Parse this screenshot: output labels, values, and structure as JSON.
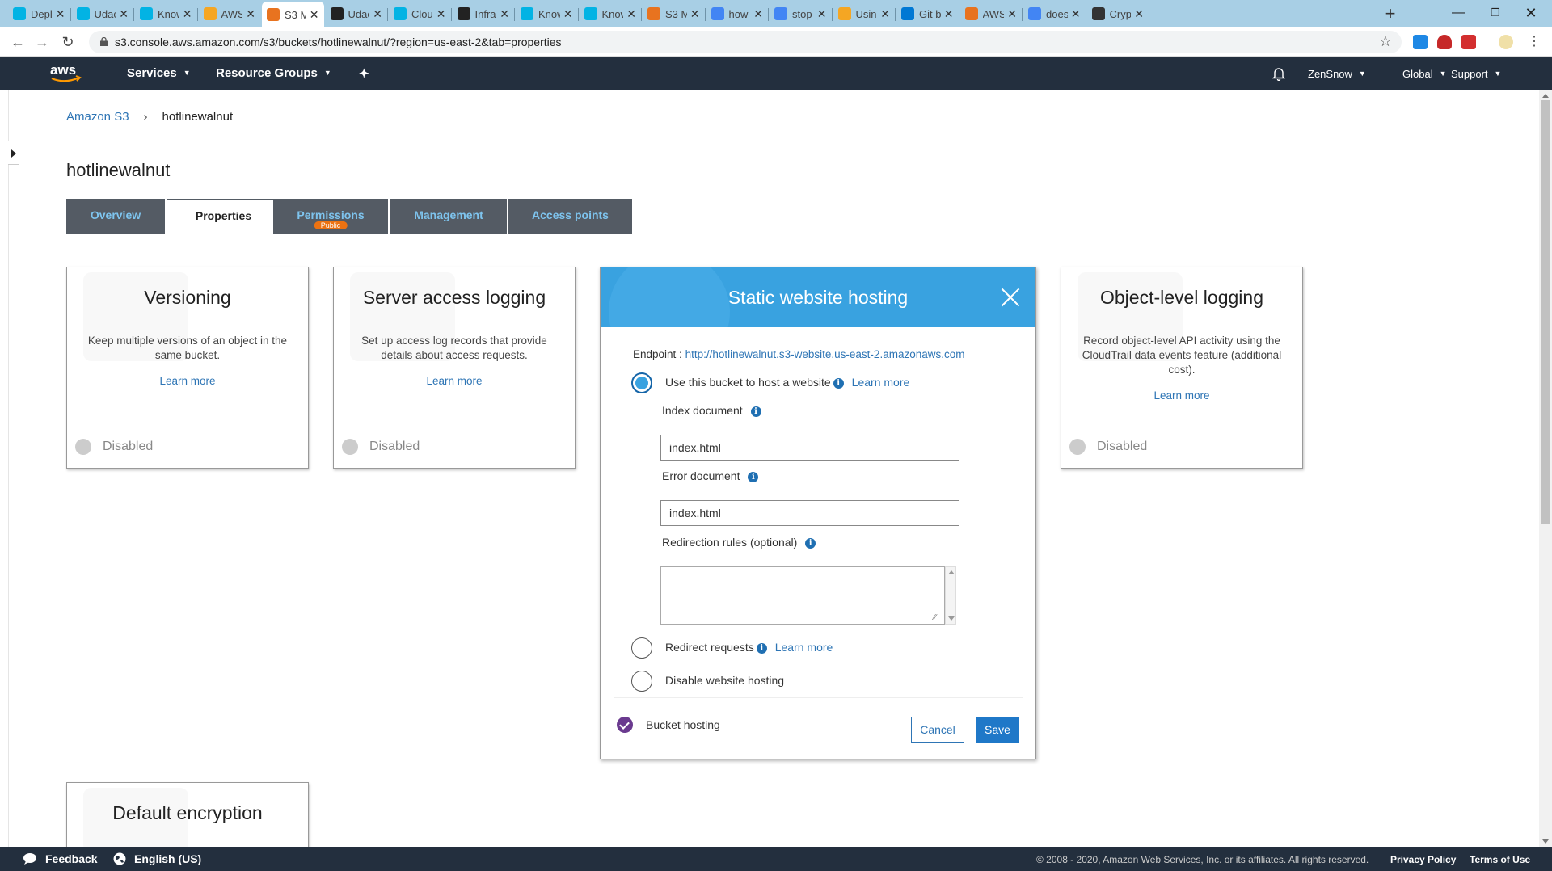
{
  "browser": {
    "tabs": [
      {
        "title": "Deplo",
        "icon": "udacity-icon",
        "color": "#02b3e4"
      },
      {
        "title": "Udaci",
        "icon": "udacity-icon",
        "color": "#02b3e4"
      },
      {
        "title": "Know",
        "icon": "udacity-icon",
        "color": "#02b3e4"
      },
      {
        "title": "AWS",
        "icon": "aws-box-icon",
        "color": "#f5a623"
      },
      {
        "title": "S3 M",
        "icon": "aws-s3-icon",
        "color": "#e8731f"
      },
      {
        "title": "Udaci",
        "icon": "github-icon",
        "color": "#222222"
      },
      {
        "title": "Clouc",
        "icon": "udacity-icon",
        "color": "#02b3e4"
      },
      {
        "title": "Infras",
        "icon": "wikipedia-icon",
        "color": "#222222"
      },
      {
        "title": "Know",
        "icon": "udacity-icon",
        "color": "#02b3e4"
      },
      {
        "title": "Know",
        "icon": "udacity-icon",
        "color": "#02b3e4"
      },
      {
        "title": "S3 M",
        "icon": "aws-s3-icon",
        "color": "#e8731f"
      },
      {
        "title": "how t",
        "icon": "google-icon",
        "color": "#4285f4"
      },
      {
        "title": "stop",
        "icon": "google-icon",
        "color": "#4285f4"
      },
      {
        "title": "Using",
        "icon": "aws-box-icon",
        "color": "#f5a623"
      },
      {
        "title": "Git b",
        "icon": "azure-icon",
        "color": "#0078d4"
      },
      {
        "title": "AWS",
        "icon": "aws-s3-icon",
        "color": "#e8731f"
      },
      {
        "title": "does",
        "icon": "google-icon",
        "color": "#4285f4"
      },
      {
        "title": "Crypt",
        "icon": "crypto-icon",
        "color": "#333333"
      }
    ],
    "active_tab_index": 4,
    "url": "s3.console.aws.amazon.com/s3/buckets/hotlinewalnut/?region=us-east-2&tab=properties"
  },
  "awsnav": {
    "services": "Services",
    "resource_groups": "Resource Groups",
    "user": "ZenSnow",
    "region": "Global",
    "support": "Support"
  },
  "breadcrumb": {
    "root": "Amazon S3",
    "current": "hotlinewalnut"
  },
  "bucket": {
    "name": "hotlinewalnut"
  },
  "tabs": {
    "overview": "Overview",
    "properties": "Properties",
    "permissions": "Permissions",
    "permissions_badge": "Public",
    "management": "Management",
    "access_points": "Access points"
  },
  "cards": {
    "versioning": {
      "title": "Versioning",
      "description": "Keep multiple versions of an object in the same bucket.",
      "link": "Learn more",
      "status": "Disabled"
    },
    "server_logging": {
      "title": "Server access logging",
      "description": "Set up access log records that provide details about access requests.",
      "link": "Learn more",
      "status": "Disabled"
    },
    "object_logging": {
      "title": "Object-level logging",
      "description": "Record object-level API activity using the CloudTrail data events feature (additional cost).",
      "link": "Learn more",
      "status": "Disabled"
    },
    "default_encryption": {
      "title": "Default encryption"
    }
  },
  "static_hosting": {
    "title": "Static website hosting",
    "endpoint_label": "Endpoint :",
    "endpoint_url": "http://hotlinewalnut.s3-website.us-east-2.amazonaws.com",
    "option_host": "Use this bucket to host a website",
    "learn_more": "Learn more",
    "index_label": "Index document",
    "index_value": "index.html",
    "error_label": "Error document",
    "error_value": "index.html",
    "rules_label": "Redirection rules (optional)",
    "option_redirect": "Redirect requests",
    "option_disable": "Disable website hosting",
    "selected_option": "host",
    "footer_status": "Bucket hosting",
    "cancel": "Cancel",
    "save": "Save"
  },
  "footer": {
    "feedback": "Feedback",
    "language": "English (US)",
    "copyright": "© 2008 - 2020, Amazon Web Services, Inc. or its affiliates. All rights reserved.",
    "privacy": "Privacy Policy",
    "terms": "Terms of Use"
  },
  "colors": {
    "aws_nav": "#232f3e",
    "tab_inactive": "#545b64",
    "tab_text": "#7ec4ee",
    "hosting_header": "#39a2e0",
    "link": "#2e75b5",
    "public_badge": "#ec7211",
    "save_button": "#1f78c8"
  }
}
